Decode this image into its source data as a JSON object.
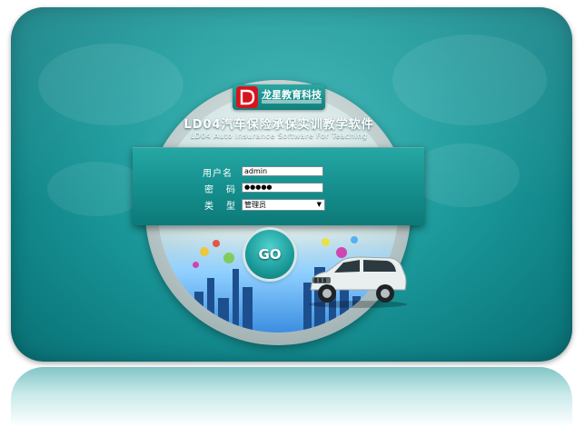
{
  "logo": {
    "text": "龙星教育科技"
  },
  "header": {
    "title": "LD04汽车保险承保实训教学软件",
    "subtitle": "LD04 Auto Insurance Software For Teaching"
  },
  "form": {
    "username_label": "用户名",
    "username_value": "admin",
    "password_label": "密　码",
    "password_mask": "●●●●●",
    "type_label": "类　型",
    "type_selected": "管理员"
  },
  "buttons": {
    "go_label": "GO"
  },
  "colors": {
    "accent": "#1c9a9c",
    "logo_red": "#d8141c"
  }
}
